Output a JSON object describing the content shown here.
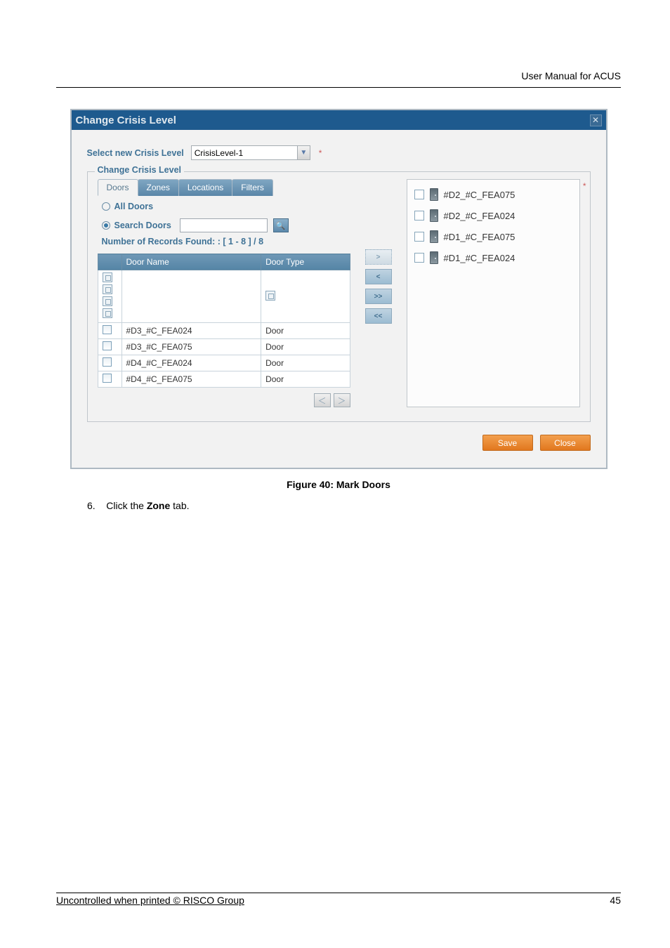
{
  "header": {
    "title": "User Manual for ACUS"
  },
  "dialog": {
    "title": "Change Crisis Level",
    "select_label": "Select new Crisis Level",
    "select_value": "CrisisLevel-1",
    "fieldset_legend": "Change Crisis Level",
    "tabs": [
      "Doors",
      "Zones",
      "Locations",
      "Filters"
    ],
    "active_tab_index": 0,
    "radio_all": "All Doors",
    "radio_search": "Search Doors",
    "records_found": "Number of Records Found: : [ 1 - 8 ] / 8",
    "table": {
      "headers": [
        "",
        "Door Name",
        "Door Type"
      ],
      "rows": [
        {
          "name": "#D3_#C_FEA024",
          "type": "Door"
        },
        {
          "name": "#D3_#C_FEA075",
          "type": "Door"
        },
        {
          "name": "#D4_#C_FEA024",
          "type": "Door"
        },
        {
          "name": "#D4_#C_FEA075",
          "type": "Door"
        }
      ]
    },
    "right_list": [
      "#D2_#C_FEA075",
      "#D2_#C_FEA024",
      "#D1_#C_FEA075",
      "#D1_#C_FEA024"
    ],
    "buttons": {
      "save": "Save",
      "close": "Close"
    },
    "move": {
      "add": ">",
      "rem": "<",
      "addall": ">>",
      "remall": "<<"
    }
  },
  "caption": "Figure 40: Mark Doors",
  "instruction": {
    "number": "6.",
    "prefix": "Click the ",
    "bold": "Zone",
    "suffix": " tab."
  },
  "footer": {
    "left": "Uncontrolled when printed © RISCO Group",
    "right": "45"
  }
}
